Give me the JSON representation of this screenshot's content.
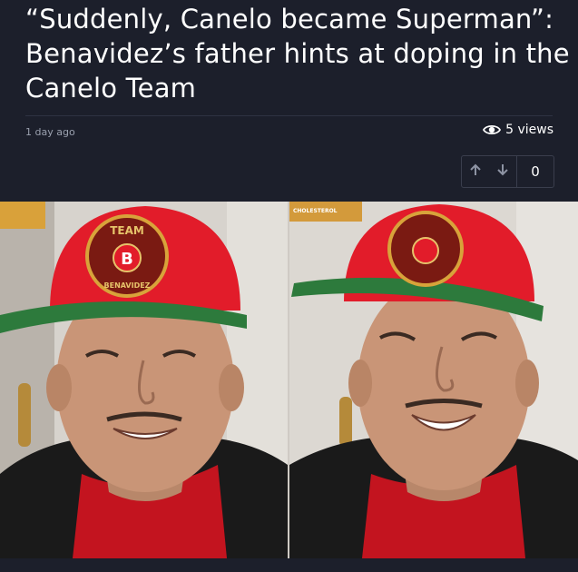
{
  "article": {
    "headline": "“Suddenly, Canelo became Superman”: Benavidez’s father hints at doping in the Canelo Team",
    "timestamp": "1 day ago",
    "views_label": "5 views"
  },
  "votes": {
    "up_icon": "arrow-up-icon",
    "down_icon": "arrow-down-icon",
    "count": "0"
  },
  "image": {
    "cap_text_top": "TEAM",
    "cap_text_center": "B",
    "cap_text_bottom": "BENAVIDEZ",
    "background_sign": "CHOLESTEROL"
  },
  "colors": {
    "background": "#1c1f2b",
    "cap_red": "#e21c2a",
    "cap_brim_green": "#2d7a3c",
    "hoodie": "#1a1a1a"
  }
}
